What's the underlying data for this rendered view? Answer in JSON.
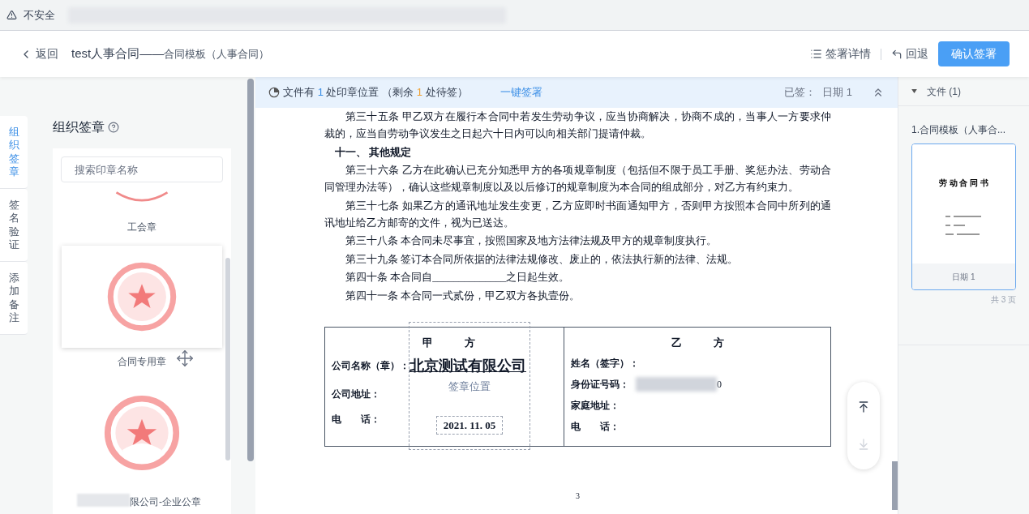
{
  "browser": {
    "security_label": "不安全"
  },
  "header": {
    "back": "返回",
    "title": "test人事合同——",
    "subtitle": "合同模板（人事合同）",
    "actions": [
      {
        "label": "签署详情",
        "kind": "list"
      },
      {
        "label": "回退",
        "kind": "undo"
      }
    ],
    "confirm": "确认签署"
  },
  "side_tabs": [
    {
      "label": "组织签章",
      "selected": true
    },
    {
      "label": "签名验证",
      "selected": false
    },
    {
      "label": "添加备注",
      "selected": false
    }
  ],
  "seal_panel": {
    "title": "组织签章",
    "search": {
      "placeholder": "搜索印章名称"
    },
    "seals": [
      {
        "name": "工会章",
        "kind": "cut",
        "selected": false
      },
      {
        "name": "合同专用章",
        "kind": "full",
        "selected": true
      },
      {
        "name": "限公司-企业公章",
        "kind": "redacted",
        "selected": false
      }
    ]
  },
  "banner": {
    "prefix": "文件有",
    "count": "1",
    "middle": "处印章位置",
    "remaining_prefix": "（剩余",
    "remaining": "1",
    "remaining_suffix": "处待签）",
    "action": "一键签署",
    "signed_label": "已签：",
    "signed_item": "日期 1"
  },
  "document": {
    "paragraphs": [
      {
        "kind": "para",
        "text": "第三十五条 甲乙双方在履行本合同中若发生劳动争议，应当协商解决，协商不成的，当事人一方要求仲裁的，应当自劳动争议发生之日起六十日内可以向相关部门提请仲裁。"
      },
      {
        "kind": "heading",
        "text": "十一、 其他规定"
      },
      {
        "kind": "para",
        "text": "第三十六条 乙方在此确认已充分知悉甲方的各项规章制度（包括但不限于员工手册、奖惩办法、劳动合同管理办法等），确认这些规章制度以及以后修订的规章制度为本合同的组成部分，对乙方有约束力。"
      },
      {
        "kind": "para",
        "text": "第三十七条 如果乙方的通讯地址发生变更，乙方应即时书面通知甲方，否则甲方按照本合同中所列的通讯地址给乙方邮寄的文件，视为已送达。"
      },
      {
        "kind": "para",
        "text": "第三十八条 本合同未尽事宜，按照国家及地方法律法规及甲方的规章制度执行。"
      },
      {
        "kind": "para",
        "text": "第三十九条 签订本合同所依据的法律法规修改、废止的，依法执行新的法律、法规。"
      },
      {
        "kind": "para",
        "text": "第四十条 本合同自______________之日起生效。"
      },
      {
        "kind": "para",
        "text": "第四十一条 本合同一式贰份，甲乙双方各执壹份。"
      }
    ],
    "table": {
      "party_a": {
        "heading": "甲　　　方",
        "fields": [
          "公司名称（章）：",
          "公司地址：",
          "电　　话："
        ],
        "company": "北京测试有限公司",
        "stamp_area": "签章位置",
        "date": "2021. 11. 05"
      },
      "party_b": {
        "heading": "乙　　　方",
        "fields": [
          "姓名（签字）：",
          "身份证号码：",
          "家庭地址：",
          "电　　话："
        ],
        "id_tail": "0"
      }
    },
    "page_number": "3"
  },
  "files": {
    "header": "文件 (1)",
    "expanded": true,
    "items": [
      {
        "name": "1.合同模板（人事合...",
        "thumb_title": "劳 动 合 同 书",
        "label": "日期 1",
        "pages": "共 3 页",
        "selected": true
      }
    ]
  }
}
